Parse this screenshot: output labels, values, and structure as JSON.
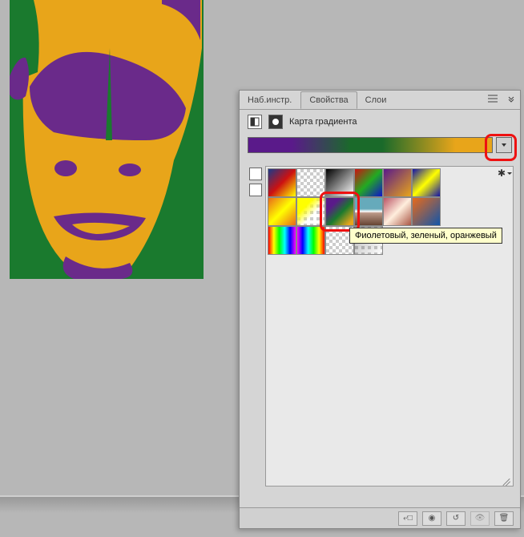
{
  "tabs": {
    "tools": "Наб.инстр.",
    "properties": "Свойства",
    "layers": "Слои"
  },
  "properties": {
    "title": "Карта градиента"
  },
  "tooltip": {
    "text": "Фиолетовый, зеленый, оранжевый"
  },
  "gradient_presets": [
    {
      "name": "Сине-красно-желтый",
      "style": "linear-gradient(135deg,#1a3a8a,#c11,#ff0)"
    },
    {
      "name": "Прозрачный",
      "class": "checker"
    },
    {
      "name": "Черно-белый",
      "style": "linear-gradient(135deg,#000,#fff)"
    },
    {
      "name": "Красно-зеленый",
      "style": "linear-gradient(135deg,#c11,#2a2,#11c)"
    },
    {
      "name": "Фиолетово-оранжевый",
      "style": "linear-gradient(135deg,#5a1a8a,#e8a51a)"
    },
    {
      "name": "Сине-желто-синий",
      "style": "linear-gradient(135deg,#11a,#ff0,#11a)"
    },
    {
      "name": "Оранжево-желтый",
      "style": "linear-gradient(135deg,#e86a1a,#ff0,#e86a1a)"
    },
    {
      "name": "Желтый прозрачный",
      "style": "linear-gradient(135deg,#ff0 30%,transparent 60%)",
      "class": "checker"
    },
    {
      "name": "Фиолетовый, зеленый, оранжевый",
      "style": "linear-gradient(135deg,#5a1a8a 25%,#1a7a2e 55%,#e8a51a 90%)"
    },
    {
      "name": "Хром",
      "style": "linear-gradient(180deg,#6ab 40%,#fff 50%,#b98 55%,#643 100%)"
    },
    {
      "name": "Медь",
      "style": "linear-gradient(135deg,#b56,#fed,#a54)"
    },
    {
      "name": "Оранжево-синий",
      "style": "linear-gradient(135deg,#e86a1a,#15a)"
    },
    {
      "name": "Радуга 1",
      "style": "linear-gradient(90deg,#f00,#ff0,#0f0,#0ff,#00f,#f0f)"
    },
    {
      "name": "Радуга 2",
      "style": "linear-gradient(90deg,#f0f,#00f,#0ff,#0f0,#ff0,#f00)"
    },
    {
      "name": "Прозрачные полосы",
      "class": "checker"
    },
    {
      "name": "Прозрачный градиент",
      "style": "linear-gradient(135deg,rgba(0,0,0,0.3),transparent)",
      "class": "checker"
    }
  ],
  "selected_preset_index": 8,
  "colors": {
    "highlight": "#e11111"
  }
}
